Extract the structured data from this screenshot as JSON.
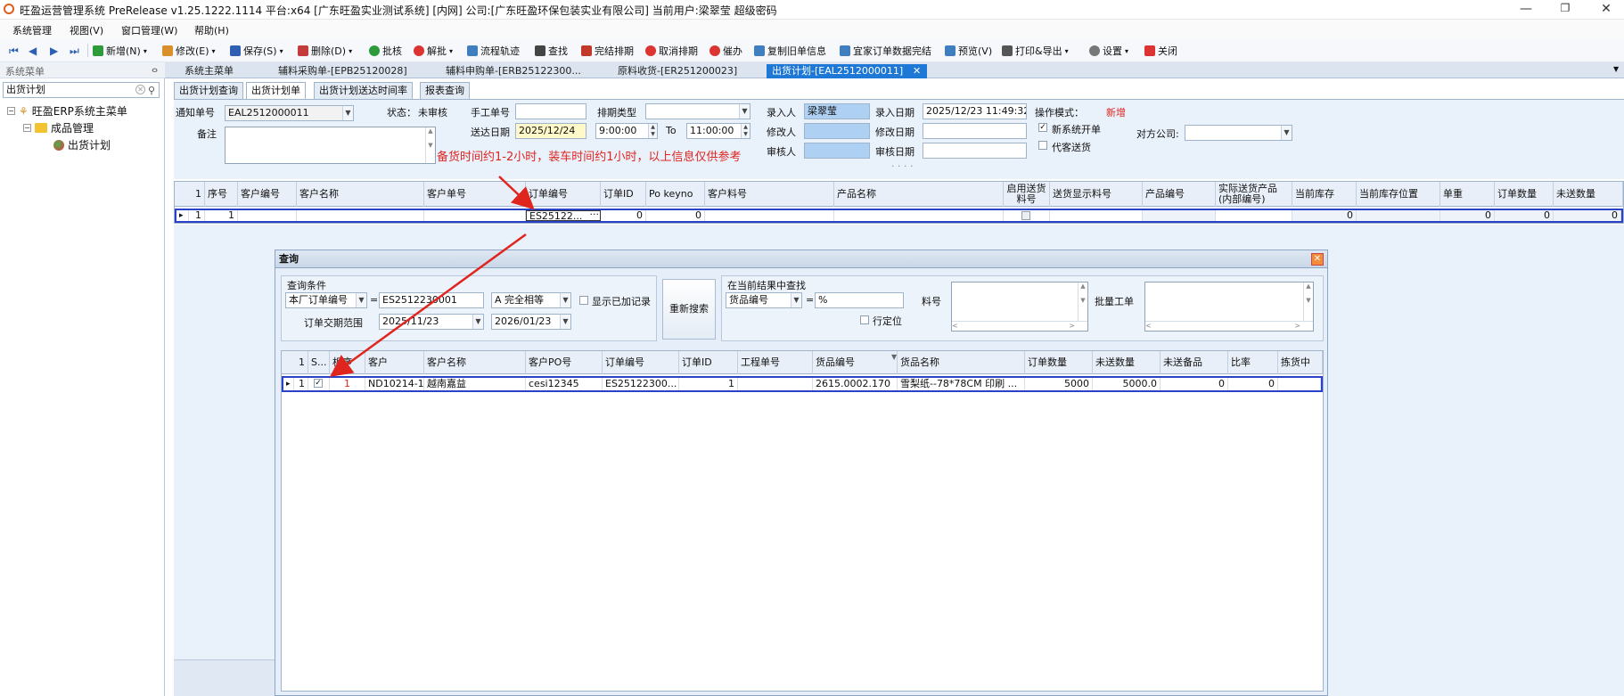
{
  "app": {
    "title": "旺盈运营管理系统 PreRelease v1.25.1222.1114 平台:x64 [广东旺盈实业测试系统] [内网] 公司:[广东旺盈环保包装实业有限公司] 当前用户:梁翠莹 超级密码",
    "min": "—",
    "max": "❐",
    "close": "✕"
  },
  "menu": [
    "系统管理",
    "视图(V)",
    "窗口管理(W)",
    "帮助(H)"
  ],
  "toolbar": {
    "items": [
      {
        "label": "新增(N)",
        "color": "#2e9b3a"
      },
      {
        "label": "修改(E)",
        "color": "#d9902b"
      },
      {
        "label": "保存(S)",
        "color": "#2f5fb3"
      },
      {
        "label": "删除(D)",
        "color": "#c53a3a"
      },
      {
        "label": "批核",
        "color": "#2e9b3a"
      },
      {
        "label": "解批",
        "color": "#d33"
      },
      {
        "label": "流程轨迹",
        "color": "#3f7fbf"
      },
      {
        "label": "查找",
        "color": "#444"
      },
      {
        "label": "完结排期",
        "color": "#c0392b"
      },
      {
        "label": "取消排期",
        "color": "#d33"
      },
      {
        "label": "催办",
        "color": "#d33"
      },
      {
        "label": "复制旧单信息",
        "color": "#3f7fbf"
      },
      {
        "label": "宜家订单数据完结",
        "color": "#3f7fbf"
      },
      {
        "label": "预览(V)",
        "color": "#3f7fbf"
      },
      {
        "label": "打印&导出",
        "color": "#555"
      },
      {
        "label": "设置",
        "color": "#777"
      },
      {
        "label": "关闭",
        "color": "#d33"
      }
    ]
  },
  "leftpane": {
    "header": "系统菜单",
    "pin": "ⴰ",
    "search": "出货计划",
    "tree": [
      "旺盈ERP系统主菜单",
      "成品管理",
      "出货计划"
    ]
  },
  "tabs": [
    "系统主菜单",
    "辅料采购单-[EPB25120028]",
    "辅料申购单-[ERB25122300...",
    "原料收货-[ER251200023]",
    "出货计划-[EAL2512000011]"
  ],
  "tab_close": "✕",
  "subtabs": [
    "出货计划查询",
    "出货计划单",
    "出货计划送达时间率",
    "报表查询"
  ],
  "form": {
    "notice_no_label": "通知单号",
    "notice_no": "EAL2512000011",
    "status_label": "状态：",
    "status": "未审核",
    "manual_no_label": "手工单号",
    "manual_no": "",
    "schedule_type_label": "排期类型",
    "schedule_type": "",
    "entered_by_label": "录入人",
    "entered_by": "梁翠莹",
    "entry_date_label": "录入日期",
    "entry_date": "2025/12/23 11:49:32",
    "op_mode_label": "操作模式：",
    "op_mode": "新增",
    "remark_label": "备注",
    "remark": "",
    "delivery_date_label": "送达日期",
    "delivery_date": "2025/12/24",
    "time_from": "9:00:00",
    "to_label": "To",
    "time_to": "11:00:00",
    "modified_by_label": "修改人",
    "modify_date_label": "修改日期",
    "reviewer_label": "审核人",
    "review_date_label": "审核日期",
    "new_system_label": "新系统开单",
    "proxy_label": "代客送货",
    "counterparty_label": "对方公司:",
    "annotation": "备货时间约1-2小时，装车时间约1小时，以上信息仅供参考"
  },
  "grid1": {
    "headers": [
      "1",
      "序号",
      "客户编号",
      "客户名称",
      "客户单号",
      "订单编号",
      "订单ID",
      "Po keyno",
      "客户料号",
      "产品名称",
      "启用送货料号",
      "送货显示料号",
      "产品编号",
      "实际送货产品(内部编号)",
      "当前库存",
      "当前库存位置",
      "单重",
      "订单数量",
      "未送数量"
    ],
    "row": {
      "indicator": "▸",
      "num": "1",
      "seq": "1",
      "order_no": "ES25122...",
      "ellipsis": "···",
      "order_id": "0",
      "po_keyno": "0",
      "stock": "0",
      "unit_weight": "0",
      "order_qty": "0",
      "unsent_qty": "0"
    }
  },
  "query": {
    "title": "查询",
    "close": "✕",
    "cond_group": "查询条件",
    "field": "本厂订单编号",
    "eq": "=",
    "value": "ES2512230001",
    "match": "A 完全相等",
    "show_added": "显示已加记录",
    "range_label": "订单交期范围",
    "date_from": "2025/11/23",
    "date_to": "2026/01/23",
    "search_btn": "重新搜索",
    "find_group": "在当前结果中查找",
    "find_field": "货品编号",
    "find_eq": "=",
    "find_value": "%",
    "material_label": "料号",
    "locate_label": "行定位",
    "batch_label": "批量工单",
    "headers": [
      "1",
      "S...",
      "相序",
      "客户",
      "客户名称",
      "客户PO号",
      "订单编号",
      "订单ID",
      "工程单号",
      "货品编号",
      "货品名称",
      "订单数量",
      "未送数量",
      "未送备品",
      "比率",
      "拣货中"
    ],
    "row": {
      "indicator": "▸",
      "num": "1",
      "seq": "1",
      "customer": "ND10214-1",
      "customer_name": "越南嘉益",
      "po": "cesi12345",
      "order_no": "ES25122300...",
      "order_id": "1",
      "project_no": "",
      "goods_no": "2615.0002.170",
      "goods_name": "雪梨纸--78*78CM 印刷 ...",
      "order_qty": "5000",
      "unsent_qty": "5000.0",
      "unsent_spare": "0",
      "ratio": "0",
      "picking": ""
    }
  }
}
